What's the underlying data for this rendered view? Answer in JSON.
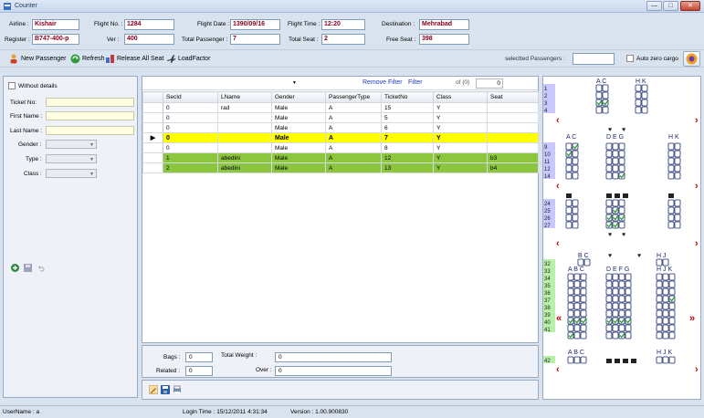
{
  "window": {
    "title": "Counter",
    "minimize": "—",
    "maximize": "□",
    "close": "✕"
  },
  "flight": {
    "airline_label": "Airline :",
    "airline": "Kishair",
    "flight_no_label": "Flight No. :",
    "flight_no": "1284",
    "flight_date_label": "Flight Date :",
    "flight_date": "1390/09/16",
    "flight_time_label": "Flight Time :",
    "flight_time": "12:20",
    "destination_label": "Destination :",
    "destination": "Mehrabad",
    "register_label": "Register :",
    "register": "B747-400-p",
    "ver_label": "Ver :",
    "ver": "400",
    "total_passenger_label": "Total Passenger :",
    "total_passenger": "7",
    "total_seat_label": "Total Seat :",
    "total_seat": "2",
    "free_seat_label": "Free Seat :",
    "free_seat": "398"
  },
  "toolbar": {
    "new_passenger": "New Passenger",
    "refresh": "Refresh",
    "release_all_seat": "Release All Seat",
    "load_factor": "LoadFactor",
    "selected_passengers_label": "selectted Passengers :",
    "selected_passengers_value": "",
    "auto_zero_cargo": "Auto zero cargo"
  },
  "filter": {
    "without_details": "Without details",
    "ticket_no_label": "Ticket No:",
    "first_name_label": "First Name :",
    "last_name_label": "Last Name :",
    "gender_label": "Gender :",
    "type_label": "Type :",
    "class_label": "Class :"
  },
  "grid": {
    "remove_filter": "Remove Filter",
    "filter": "Filter",
    "of_count": "of {0}",
    "page": "0",
    "columns": [
      "SecId",
      "LName",
      "Gender",
      "PassengerType",
      "TicketNo",
      "Class",
      "Seat"
    ],
    "rows": [
      {
        "secid": "0",
        "lname": "rad",
        "gender": "Male",
        "ptype": "A",
        "ticket": "15",
        "class": "Y",
        "seat": "",
        "style": ""
      },
      {
        "secid": "0",
        "lname": "",
        "gender": "Male",
        "ptype": "A",
        "ticket": "5",
        "class": "Y",
        "seat": "",
        "style": ""
      },
      {
        "secid": "0",
        "lname": "",
        "gender": "Male",
        "ptype": "A",
        "ticket": "6",
        "class": "Y",
        "seat": "",
        "style": ""
      },
      {
        "secid": "0",
        "lname": "",
        "gender": "Male",
        "ptype": "A",
        "ticket": "7",
        "class": "Y",
        "seat": "",
        "style": "yellow"
      },
      {
        "secid": "0",
        "lname": "",
        "gender": "Male",
        "ptype": "A",
        "ticket": "8",
        "class": "Y",
        "seat": "",
        "style": ""
      },
      {
        "secid": "1",
        "lname": "abedini",
        "gender": "Male",
        "ptype": "A",
        "ticket": "12",
        "class": "Y",
        "seat": "b3",
        "style": "green"
      },
      {
        "secid": "2",
        "lname": "abedini",
        "gender": "Male",
        "ptype": "A",
        "ticket": "13",
        "class": "Y",
        "seat": "b4",
        "style": "green"
      }
    ]
  },
  "bags": {
    "bags_label": "Bags :",
    "bags": "0",
    "total_weight_label": "Total Weight :",
    "total_weight": "0",
    "related_label": "Related :",
    "related": "0",
    "over_label": "Over :",
    "over": "0"
  },
  "seatmap": {
    "colors": {
      "row_upper": "#c8c8ff",
      "row_lower": "#b8f0a8",
      "arrow": "#c00000",
      "seat_border": "#1a2a6c",
      "check": "#2aa02a"
    },
    "upper_rows": [
      "1",
      "2",
      "3",
      "4"
    ],
    "upper_mid_rows": [
      "9",
      "10",
      "11",
      "12",
      "14"
    ],
    "upper_rear_rows": [
      "24",
      "25",
      "26",
      "27"
    ],
    "main_rows": [
      "32",
      "33",
      "34",
      "35",
      "36",
      "37",
      "38",
      "39",
      "40",
      "41"
    ],
    "tail_rows": [
      "42"
    ],
    "letters_ac": "A  C",
    "letters_hk": "H  K",
    "letters_deg": "D  E  G",
    "letters_bc": "B  C",
    "letters_hj": "H  J",
    "letters_abc": "A  B  C",
    "letters_defg": "D  E  F  G",
    "letters_hjk": "H  J  K"
  },
  "status": {
    "username": "UserName :  a",
    "login_time": "Login Time :  15/12/2011 4:31:34",
    "version": "Version :  1.00.900830"
  }
}
